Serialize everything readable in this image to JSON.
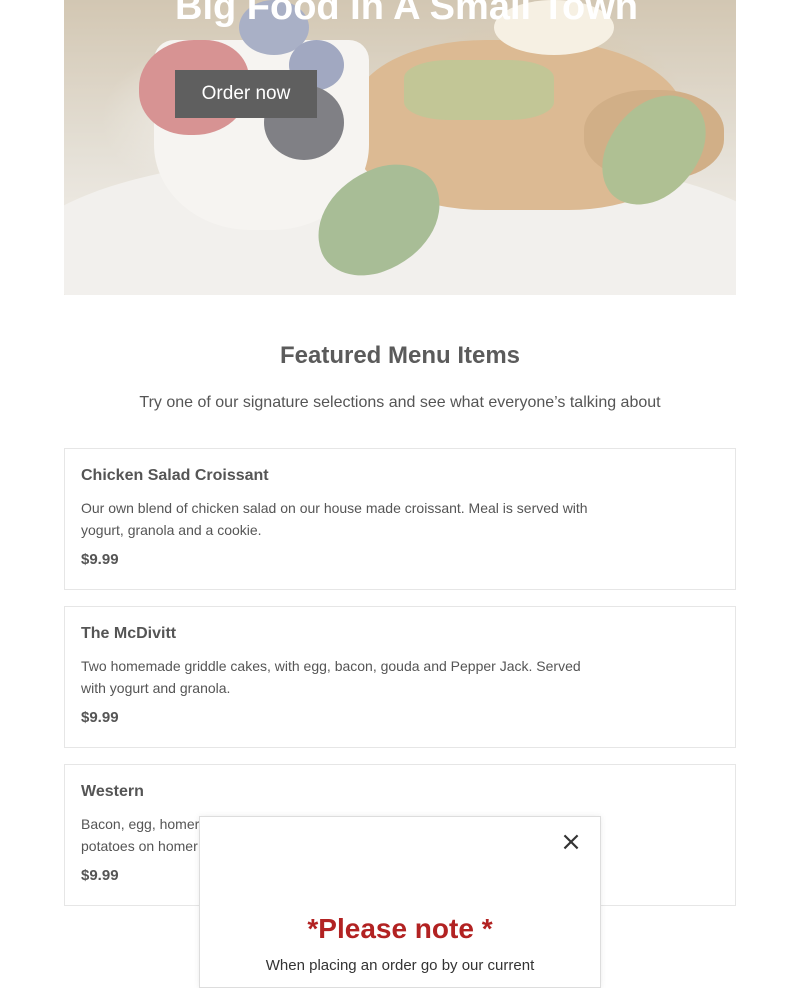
{
  "hero": {
    "title": "Big Food In A Small Town",
    "order_label": "Order now"
  },
  "featured": {
    "title": "Featured Menu Items",
    "subtitle": "Try one of our signature selections and see what everyone’s talking about"
  },
  "menu_items": [
    {
      "name": "Chicken Salad Croissant",
      "description": "Our own blend of chicken salad on our house made croissant. Meal is served with yogurt, granola and a cookie.",
      "price": "$9.99"
    },
    {
      "name": "The McDivitt",
      "description": "Two homemade griddle cakes, with egg, bacon, gouda and Pepper Jack. Served with yogurt and granola.",
      "price": "$9.99"
    },
    {
      "name": "Western",
      "description": "Bacon, egg, homer",
      "description_line2": "potatoes on homer",
      "price": "$9.99"
    }
  ],
  "modal": {
    "close_glyph": "×",
    "heading": "*Please note *",
    "body": "When placing an order go by our current"
  },
  "colors": {
    "modal_heading": "#b22222",
    "button_bg": "#5f5f5f"
  }
}
